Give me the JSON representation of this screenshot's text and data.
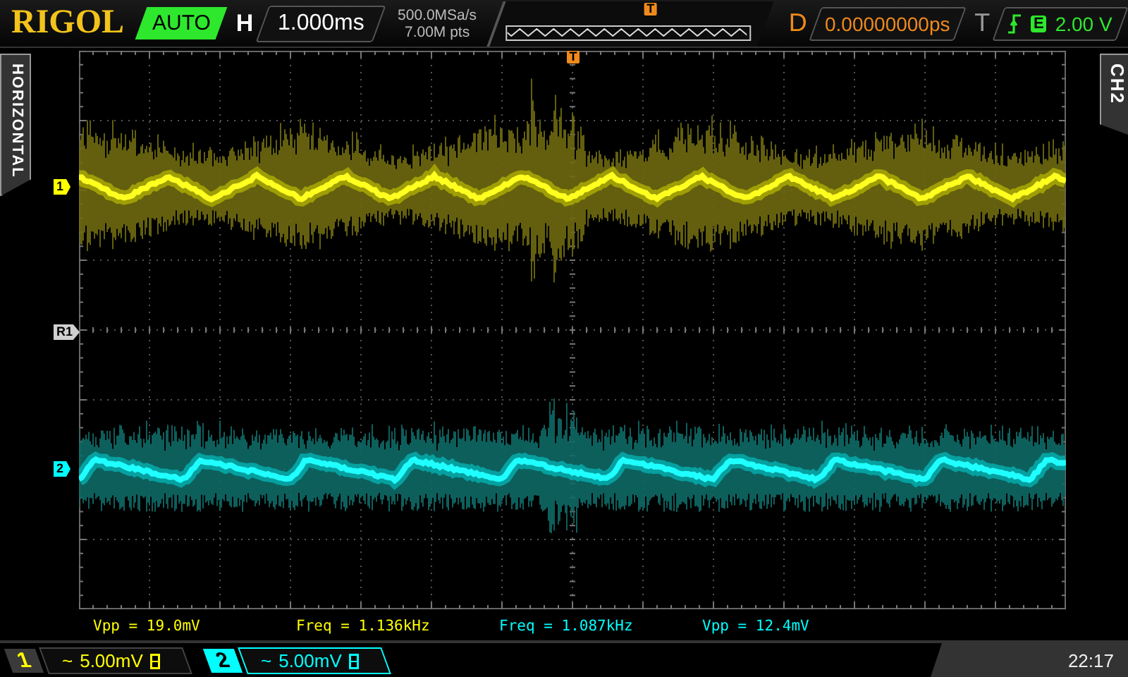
{
  "brand": "RIGOL",
  "trigger_status": "AUTO",
  "horizontal": {
    "label": "H",
    "timebase": "1.000ms",
    "sample_rate": "500.0MSa/s",
    "memory_depth": "7.00M pts",
    "trigger_marker": "T"
  },
  "delay": {
    "label": "D",
    "value": "0.00000000ps"
  },
  "trigger": {
    "label": "T",
    "source": "E",
    "level": "2.00 V"
  },
  "side_tabs": {
    "left": "HORIZONTAL",
    "right": "CH2"
  },
  "grid": {
    "trigger_marker": "T"
  },
  "markers": [
    {
      "label": "1",
      "color": "#ffff00"
    },
    {
      "label": "R1",
      "color": "#d0d0d0"
    },
    {
      "label": "2",
      "color": "#00ffff"
    }
  ],
  "measurements": [
    {
      "text": "Vpp = 19.0mV",
      "color": "#ffff00"
    },
    {
      "text": "Freq = 1.136kHz",
      "color": "#ffff00"
    },
    {
      "text": "Freq = 1.087kHz",
      "color": "#00ffff"
    },
    {
      "text": "Vpp = 12.4mV",
      "color": "#00ffff"
    }
  ],
  "channels": [
    {
      "number": "1",
      "coupling": "~",
      "scale": "5.00mV",
      "color": "#ffff00",
      "selected": false
    },
    {
      "number": "2",
      "coupling": "~",
      "scale": "5.00mV",
      "color": "#00ffff",
      "selected": true
    }
  ],
  "clock": "22:17"
}
